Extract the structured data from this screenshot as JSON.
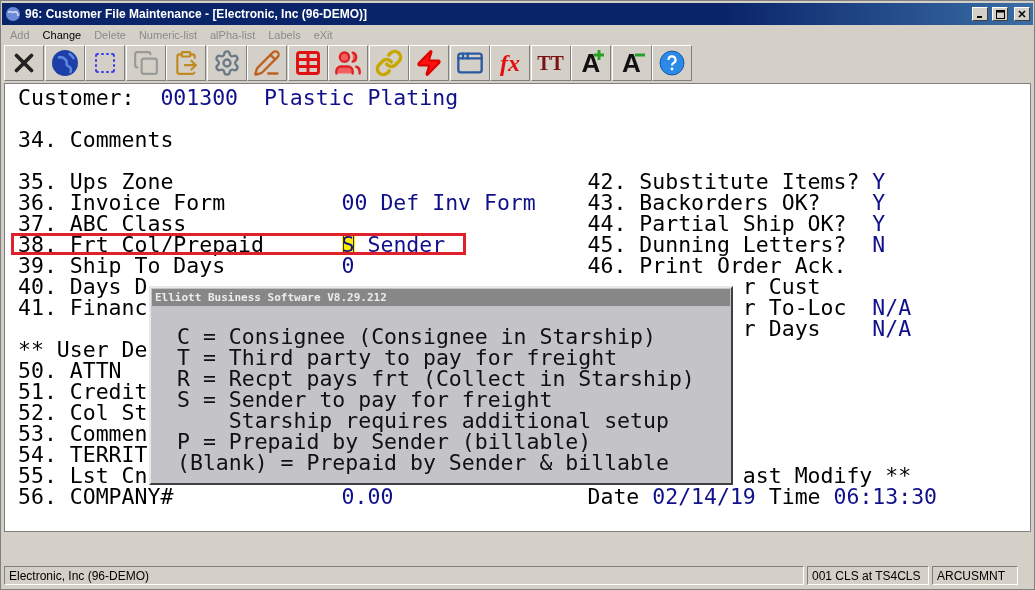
{
  "window": {
    "title": "96: Customer File Maintenance - [Electronic, Inc (96-DEMO)]"
  },
  "menu": [
    {
      "label": "Add",
      "disabled": true
    },
    {
      "label": "Change",
      "disabled": false
    },
    {
      "label": "Delete",
      "disabled": true
    },
    {
      "label": "Numeric-list",
      "disabled": true
    },
    {
      "label": "alPha-list",
      "disabled": true
    },
    {
      "label": "Labels",
      "disabled": true
    },
    {
      "label": "eXit",
      "disabled": true
    }
  ],
  "toolbar": [
    {
      "kind": "icon"
    },
    {
      "kind": "icon"
    },
    {
      "kind": "icon"
    },
    {
      "kind": "icon"
    },
    {
      "kind": "icon"
    },
    {
      "kind": "icon"
    },
    {
      "kind": "icon"
    },
    {
      "kind": "icon"
    },
    {
      "kind": "icon"
    },
    {
      "kind": "icon"
    },
    {
      "kind": "icon"
    },
    {
      "kind": "icon"
    },
    {
      "kind": "formula",
      "label": "fx"
    },
    {
      "kind": "font",
      "label": "TT"
    },
    {
      "kind": "grow",
      "label": "A"
    },
    {
      "kind": "shrink",
      "label": "A"
    },
    {
      "kind": "icon"
    }
  ],
  "screen": {
    "header": {
      "label": "Customer:",
      "code": "001300",
      "name": "Plastic Plating"
    },
    "rows": [
      {
        "kind": "blank"
      },
      {
        "kind": "field",
        "left": {
          "label": "34. Comments"
        }
      },
      {
        "kind": "blank"
      },
      {
        "kind": "field",
        "left": {
          "label": "35. Ups Zone"
        },
        "right": {
          "label": "42. Substitute Items?",
          "value": "Y"
        }
      },
      {
        "kind": "field",
        "left": {
          "label": "36. Invoice Form",
          "value": "00 Def Inv Form"
        },
        "right": {
          "label": "43. Backorders OK?",
          "value": "Y"
        }
      },
      {
        "kind": "field",
        "left": {
          "label": "37. ABC Class"
        },
        "right": {
          "label": "44. Partial Ship OK?",
          "value": "Y"
        }
      },
      {
        "kind": "field",
        "left": {
          "label": "38. Frt Col/Prepaid",
          "value": "S",
          "note": "Sender",
          "current": true
        },
        "right": {
          "label": "45. Dunning Letters?",
          "value": "N"
        }
      },
      {
        "kind": "field",
        "left": {
          "label": "39. Ship To Days",
          "value": "0"
        },
        "right": {
          "label": "46. Print Order Ack."
        }
      },
      {
        "kind": "field",
        "left": {
          "label": "40. Days D"
        },
        "right": {
          "label": "r Cust",
          "clipped": true
        }
      },
      {
        "kind": "field",
        "left": {
          "label": "41. Financ"
        },
        "right": {
          "label": "r To-Loc",
          "value": "N/A",
          "clipped": true
        }
      },
      {
        "kind": "field",
        "right": {
          "label": "r Days",
          "value": "N/A",
          "clipped": true
        }
      },
      {
        "kind": "field",
        "left": {
          "label": "** User De"
        }
      },
      {
        "kind": "field",
        "left": {
          "label": "50. ATTN"
        }
      },
      {
        "kind": "field",
        "left": {
          "label": "51. Credit"
        }
      },
      {
        "kind": "field",
        "left": {
          "label": "52. Col St"
        }
      },
      {
        "kind": "field",
        "left": {
          "label": "53. Commen"
        }
      },
      {
        "kind": "field",
        "left": {
          "label": "54. TERRIT"
        }
      },
      {
        "kind": "field",
        "left": {
          "label": "55. Lst Cn"
        },
        "right": {
          "label": "ast Modify **",
          "clipped": true
        }
      },
      {
        "kind": "field",
        "left": {
          "label": "56. COMPANY#",
          "value": "0.00"
        },
        "right": {
          "label": "Date",
          "value": "02/14/19",
          "time_label": "Time",
          "time_value": "06:13:30"
        }
      }
    ]
  },
  "popup": {
    "title": "Elliott Business Software V8.29.212",
    "lines": [
      {
        "kind": "option",
        "text": "C = Consignee (Consignee in Starship)"
      },
      {
        "kind": "option",
        "text": "T = Third party to pay for freight"
      },
      {
        "kind": "option",
        "text": "R = Recpt pays frt (Collect in Starship)"
      },
      {
        "kind": "option",
        "text": "S = Sender to pay for freight"
      },
      {
        "kind": "continuation",
        "text": "Starship requires additional setup"
      },
      {
        "kind": "option",
        "text": "P = Prepaid by Sender (billable)"
      },
      {
        "kind": "option",
        "text": "(Blank) = Prepaid by Sender & billable"
      }
    ]
  },
  "status_bar": {
    "company": "Electronic, Inc (96-DEMO)",
    "session": "001 CLS at TS4CLS",
    "program": "ARCUSMNT"
  }
}
